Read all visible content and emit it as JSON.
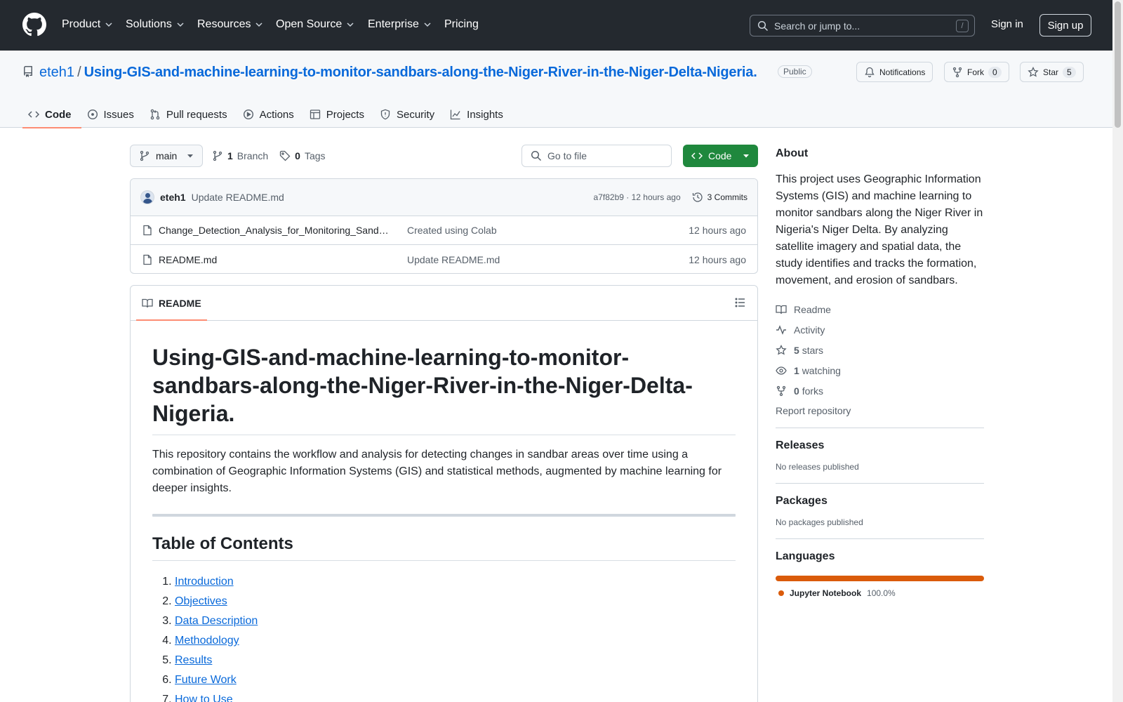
{
  "nav": {
    "items": [
      "Product",
      "Solutions",
      "Resources",
      "Open Source",
      "Enterprise",
      "Pricing"
    ],
    "search_placeholder": "Search or jump to...",
    "search_shortcut": "/",
    "sign_in": "Sign in",
    "sign_up": "Sign up"
  },
  "repo": {
    "owner": "eteh1",
    "separator": "/",
    "name": "Using-GIS-and-machine-learning-to-monitor-sandbars-along-the-Niger-River-in-the-Niger-Delta-Nigeria.",
    "visibility": "Public",
    "notifications_label": "Notifications",
    "fork_label": "Fork",
    "fork_count": "0",
    "star_label": "Star",
    "star_count": "5"
  },
  "tabs": [
    "Code",
    "Issues",
    "Pull requests",
    "Actions",
    "Projects",
    "Security",
    "Insights"
  ],
  "branch": {
    "name": "main",
    "branch_count": "1",
    "branch_label": "Branch",
    "tag_count": "0",
    "tag_label": "Tags",
    "goto_placeholder": "Go to file",
    "code_button": "Code"
  },
  "commit": {
    "author": "eteh1",
    "message": "Update README.md",
    "hash_time": "a7f82b9 · 12 hours ago",
    "commits_label": "3 Commits"
  },
  "files": [
    {
      "name": "Change_Detection_Analysis_for_Monitoring_Sandbars.ipynb",
      "commit": "Created using Colab",
      "time": "12 hours ago"
    },
    {
      "name": "README.md",
      "commit": "Update README.md",
      "time": "12 hours ago"
    }
  ],
  "readme": {
    "tab_label": "README",
    "title": "Using-GIS-and-machine-learning-to-monitor-sandbars-along-the-Niger-River-in-the-Niger-Delta-Nigeria.",
    "intro": "This repository contains the workflow and analysis for detecting changes in sandbar areas over time using a combination of Geographic Information Systems (GIS) and statistical methods, augmented by machine learning for deeper insights.",
    "toc_heading": "Table of Contents",
    "toc": [
      "Introduction",
      "Objectives",
      "Data Description",
      "Methodology",
      "Results",
      "Future Work",
      "How to Use"
    ]
  },
  "about": {
    "heading": "About",
    "description": "This project uses Geographic Information Systems (GIS) and machine learning to monitor sandbars along the Niger River in Nigeria's Niger Delta. By analyzing satellite imagery and spatial data, the study identifies and tracks the formation, movement, and erosion of sandbars.",
    "readme_link": "Readme",
    "activity_link": "Activity",
    "stars_count": "5",
    "stars_label": "stars",
    "watching_count": "1",
    "watching_label": "watching",
    "forks_count": "0",
    "forks_label": "forks",
    "report": "Report repository"
  },
  "releases": {
    "heading": "Releases",
    "empty": "No releases published"
  },
  "packages": {
    "heading": "Packages",
    "empty": "No packages published"
  },
  "languages": {
    "heading": "Languages",
    "items": [
      {
        "name": "Jupyter Notebook",
        "percent": "100.0%",
        "color": "#DA5B0B"
      }
    ]
  }
}
